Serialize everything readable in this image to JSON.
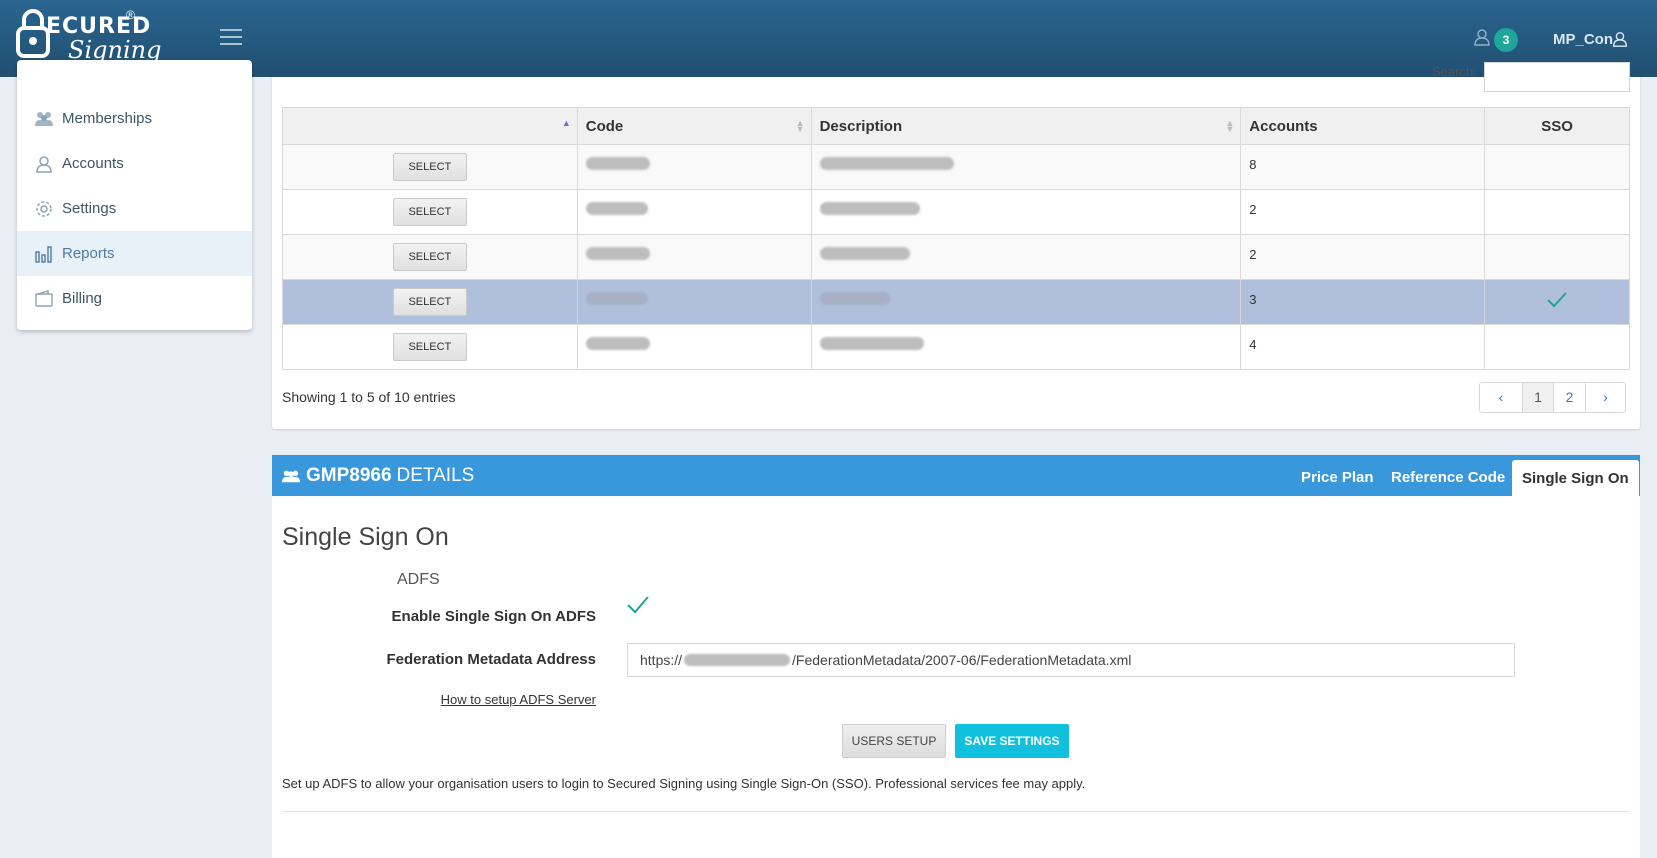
{
  "header": {
    "logo_top": "ECURED",
    "logo_bottom": "Signing",
    "logo_reg": "®",
    "notifications_count": "3",
    "username": "MP_Con"
  },
  "sidebar": {
    "items": [
      {
        "label": "Memberships",
        "icon": "users-icon"
      },
      {
        "label": "Accounts",
        "icon": "user-icon"
      },
      {
        "label": "Settings",
        "icon": "gear-icon"
      },
      {
        "label": "Reports",
        "icon": "bar-chart-icon",
        "active": true
      },
      {
        "label": "Billing",
        "icon": "wallet-icon"
      }
    ]
  },
  "table": {
    "search_label": "Search:",
    "columns": [
      "",
      "Code",
      "Description",
      "Accounts",
      "SSO"
    ],
    "select_label": "SELECT",
    "rows": [
      {
        "accounts": "8",
        "sso": false
      },
      {
        "accounts": "2",
        "sso": false
      },
      {
        "accounts": "2",
        "sso": false
      },
      {
        "accounts": "3",
        "sso": true,
        "selected": true
      },
      {
        "accounts": "4",
        "sso": false
      }
    ],
    "showing": "Showing 1 to 5 of 10 entries",
    "pager": [
      "‹",
      "1",
      "2",
      "›"
    ],
    "current_page": "1"
  },
  "details": {
    "code": "GMP8966",
    "title_suffix": "DETAILS",
    "tabs": [
      "Price Plan",
      "Reference Code",
      "Single Sign On"
    ],
    "active_tab": "Single Sign On",
    "heading": "Single Sign On",
    "section": "ADFS",
    "enable_label": "Enable Single Sign On ADFS",
    "metadata_label": "Federation Metadata Address",
    "metadata_prefix": "https://",
    "metadata_suffix": "/FederationMetadata/2007-06/FederationMetadata.xml",
    "howto_link": "How to setup ADFS Server",
    "users_setup_button": "USERS SETUP",
    "save_button": "SAVE SETTINGS",
    "note": "Set up ADFS to allow your organisation users to login to Secured Signing using Single Sign-On (SSO). Professional services fee may apply."
  },
  "colors": {
    "header": "#26587d",
    "accent": "#3898db",
    "check": "#1fa59a",
    "save": "#11c0dd",
    "selected_row": "#b0bfdc"
  }
}
